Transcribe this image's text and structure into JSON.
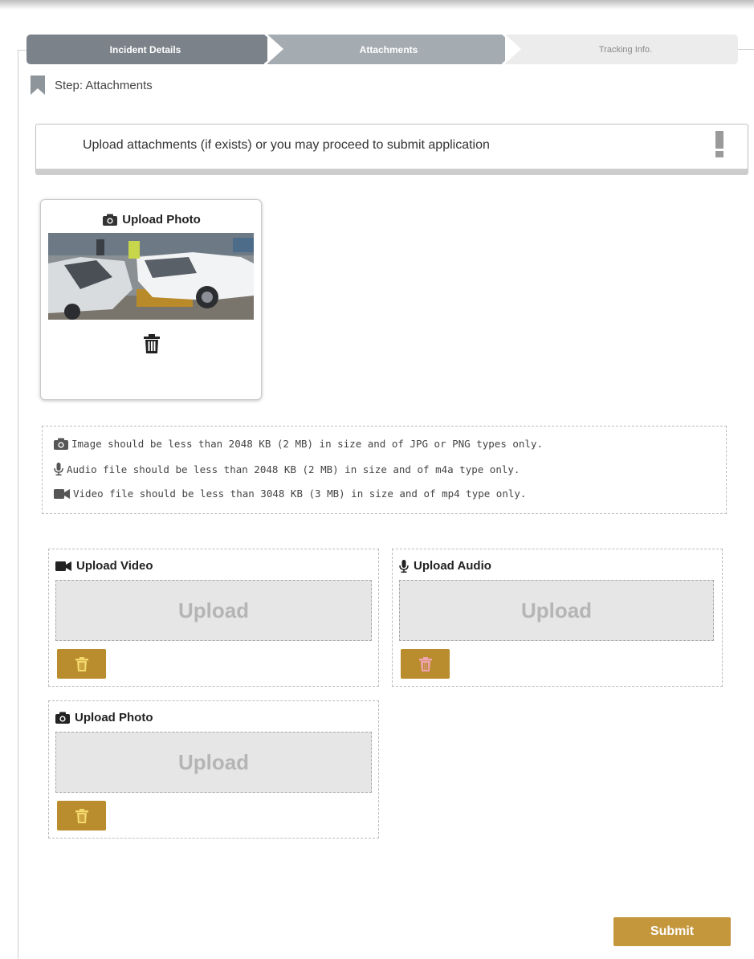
{
  "stepper": {
    "steps": [
      {
        "label": "Incident Details"
      },
      {
        "label": "Attachments"
      },
      {
        "label": "Tracking Info."
      }
    ]
  },
  "step_indicator": {
    "label": "Step: Attachments"
  },
  "notice": {
    "text": "Upload attachments (if exists) or you may proceed to submit application"
  },
  "uploaded_photo": {
    "title": "Upload Photo"
  },
  "rules": [
    "Image should be less than 2048 KB (2 MB) in size and of JPG or PNG types only.",
    "Audio file should be less than 2048 KB (2 MB) in size and of m4a type only.",
    "Video file should be less than 3048 KB (3 MB) in size and of mp4 type only."
  ],
  "uploads": {
    "video": {
      "title": "Upload Video",
      "button": "Upload"
    },
    "audio": {
      "title": "Upload Audio",
      "button": "Upload"
    },
    "photo": {
      "title": "Upload Photo",
      "button": "Upload"
    }
  },
  "submit": {
    "label": "Submit"
  },
  "colors": {
    "accent_gold": "#b98c2e",
    "submit_gold": "#c4973d",
    "step_active": "#7b8289",
    "step_current": "#a4abb1",
    "step_pending": "#ececec"
  },
  "icons": [
    "bookmark-icon",
    "exclamation-icon",
    "camera-icon",
    "microphone-icon",
    "video-camera-icon",
    "trash-icon"
  ]
}
